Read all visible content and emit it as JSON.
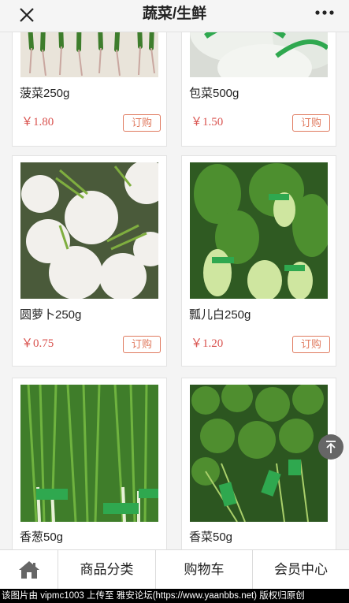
{
  "header": {
    "title": "蔬菜/生鲜",
    "close_icon": "close-icon",
    "more_icon": "more-dots-icon"
  },
  "products": [
    {
      "name": "菠菜250g",
      "price": "￥1.80",
      "buy_label": "订购",
      "image": "spinach"
    },
    {
      "name": "包菜500g",
      "price": "￥1.50",
      "buy_label": "订购",
      "image": "cabbage"
    },
    {
      "name": "圆萝卜250g",
      "price": "￥0.75",
      "buy_label": "订购",
      "image": "turnip"
    },
    {
      "name": "瓢儿白250g",
      "price": "￥1.20",
      "buy_label": "订购",
      "image": "bok-choy"
    },
    {
      "name": "香葱50g",
      "price": "",
      "buy_label": "",
      "image": "scallion"
    },
    {
      "name": "香菜50g",
      "price": "",
      "buy_label": "",
      "image": "cilantro"
    }
  ],
  "back_to_top_icon": "arrow-up-bar-icon",
  "tabbar": {
    "home_icon": "home-icon",
    "tabs": [
      "商品分类",
      "购物车",
      "会员中心"
    ]
  },
  "watermark": "该图片由 vipmc1003 上传至 雅安论坛(https://www.yaanbbs.net) 版权归原创",
  "colors": {
    "price": "#d9534f",
    "buy_border": "#e07a5f",
    "produce_green": "#3f8a2e",
    "tag_green": "#2fa84f"
  }
}
